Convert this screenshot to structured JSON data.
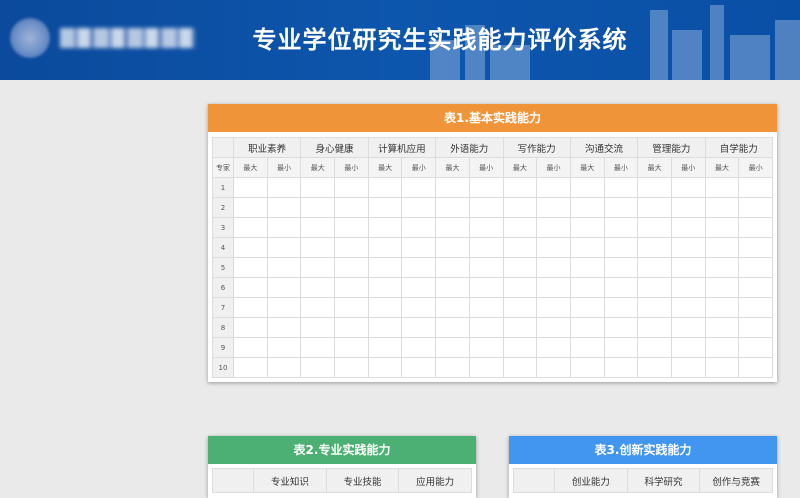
{
  "header": {
    "title": "专业学位研究生实践能力评价系统",
    "logo_text": "██████",
    "bg_color": "#0b4a9c"
  },
  "table1": {
    "title": "表1.基本实践能力",
    "head_color": "#f0943a",
    "expert_label": "专家",
    "max_label": "最大",
    "min_label": "最小",
    "categories": [
      "职业素养",
      "身心健康",
      "计算机应用",
      "外语能力",
      "写作能力",
      "沟通交流",
      "管理能力",
      "自学能力"
    ],
    "rows": [
      "1",
      "2",
      "3",
      "4",
      "5",
      "6",
      "7",
      "8",
      "9",
      "10"
    ]
  },
  "table2": {
    "title": "表2.专业实践能力",
    "head_color": "#4caf73",
    "categories": [
      "专业知识",
      "专业技能",
      "应用能力"
    ]
  },
  "table3": {
    "title": "表3.创新实践能力",
    "head_color": "#4396f0",
    "categories": [
      "创业能力",
      "科学研究",
      "创作与竞赛"
    ]
  }
}
